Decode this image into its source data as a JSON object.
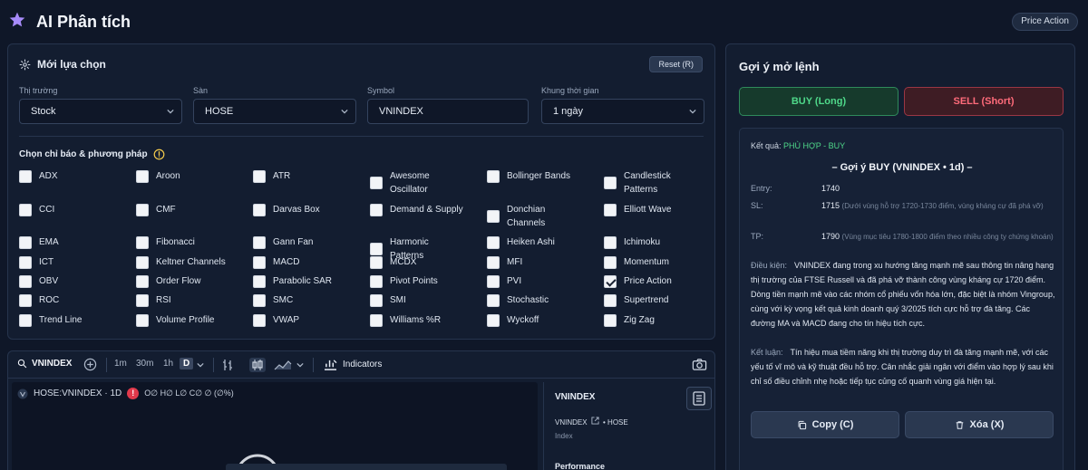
{
  "header": {
    "title": "AI Phân tích",
    "mode_badge": "Price Action"
  },
  "selection": {
    "title": "Mới lựa chọn",
    "reset_label": "Reset (R)",
    "fields": [
      {
        "label": "Thị trường",
        "value": "Stock"
      },
      {
        "label": "Sàn",
        "value": "HOSE"
      },
      {
        "label": "Symbol",
        "value": "VNINDEX"
      },
      {
        "label": "Khung thời gian",
        "value": "1 ngày"
      }
    ],
    "indicators_label": "Chọn chỉ báo & phương pháp",
    "indicators": [
      {
        "label": "ADX",
        "checked": false
      },
      {
        "label": "Aroon",
        "checked": false
      },
      {
        "label": "ATR",
        "checked": false
      },
      {
        "label": "Awesome Oscillator",
        "checked": false
      },
      {
        "label": "Bollinger Bands",
        "checked": false
      },
      {
        "label": "Candlestick Patterns",
        "checked": false
      },
      {
        "label": "CCI",
        "checked": false
      },
      {
        "label": "CMF",
        "checked": false
      },
      {
        "label": "Darvas Box",
        "checked": false
      },
      {
        "label": "Demand & Supply",
        "checked": false
      },
      {
        "label": "Donchian Channels",
        "checked": false
      },
      {
        "label": "Elliott Wave",
        "checked": false
      },
      {
        "label": "EMA",
        "checked": false
      },
      {
        "label": "Fibonacci",
        "checked": false
      },
      {
        "label": "Gann Fan",
        "checked": false
      },
      {
        "label": "Harmonic Patterns",
        "checked": false
      },
      {
        "label": "Heiken Ashi",
        "checked": false
      },
      {
        "label": "Ichimoku",
        "checked": false
      },
      {
        "label": "ICT",
        "checked": false
      },
      {
        "label": "Keltner Channels",
        "checked": false
      },
      {
        "label": "MACD",
        "checked": false
      },
      {
        "label": "MCDX",
        "checked": false
      },
      {
        "label": "MFI",
        "checked": false
      },
      {
        "label": "Momentum",
        "checked": false
      },
      {
        "label": "OBV",
        "checked": false
      },
      {
        "label": "Order Flow",
        "checked": false
      },
      {
        "label": "Parabolic SAR",
        "checked": false
      },
      {
        "label": "Pivot Points",
        "checked": false
      },
      {
        "label": "PVI",
        "checked": false
      },
      {
        "label": "Price Action",
        "checked": true
      },
      {
        "label": "ROC",
        "checked": false
      },
      {
        "label": "RSI",
        "checked": false
      },
      {
        "label": "SMC",
        "checked": false
      },
      {
        "label": "SMI",
        "checked": false
      },
      {
        "label": "Stochastic",
        "checked": false
      },
      {
        "label": "Supertrend",
        "checked": false
      },
      {
        "label": "Trend Line",
        "checked": false
      },
      {
        "label": "Volume Profile",
        "checked": false
      },
      {
        "label": "VWAP",
        "checked": false
      },
      {
        "label": "Williams %R",
        "checked": false
      },
      {
        "label": "Wyckoff",
        "checked": false
      },
      {
        "label": "Zig Zag",
        "checked": false
      }
    ]
  },
  "suggestion": {
    "title": "Gợi ý mở lệnh",
    "buy_label": "BUY (Long)",
    "sell_label": "SELL (Short)",
    "result_key": "Kết quả:",
    "result_value": "PHÙ HỢP - BUY",
    "heading": "– Gợi ý BUY (VNINDEX • 1d) –",
    "entry_key": "Entry:",
    "entry_value": "1740",
    "sl_key": "SL:",
    "sl_value": "1715",
    "sl_note": "(Dưới vùng hỗ trợ 1720-1730 điểm, vùng kháng cự đã phá vỡ)",
    "tp_key": "TP:",
    "tp_value": "1790",
    "tp_note": "(Vùng mục tiêu 1780-1800 điểm theo nhiều công ty chứng khoán)",
    "condition_key": "Điều kiện:",
    "condition_text": "VNINDEX đang trong xu hướng tăng mạnh mẽ sau thông tin nâng hạng thị trường của FTSE Russell và đã phá vỡ thành công vùng kháng cự 1720 điểm. Dòng tiền mạnh mẽ vào các nhóm cổ phiếu vốn hóa lớn, đặc biệt là nhóm Vingroup, cùng với kỳ vọng kết quả kinh doanh quý 3/2025 tích cực hỗ trợ đà tăng. Các đường MA và MACD đang cho tín hiệu tích cực.",
    "conclusion_key": "Kết luận:",
    "conclusion_text": "Tín hiệu mua tiềm năng khi thị trường duy trì đà tăng mạnh mẽ, với các yếu tố vĩ mô và kỹ thuật đều hỗ trợ. Cân nhắc giải ngân với điểm vào hợp lý sau khi chỉ số điều chỉnh nhẹ hoặc tiếp tục củng cố quanh vùng giá hiện tại.",
    "copy_label": "Copy (C)",
    "delete_label": "Xóa (X)"
  },
  "chart": {
    "symbol": "VNINDEX",
    "intervals": [
      "1m",
      "30m",
      "1h",
      "D"
    ],
    "indicators_label": "Indicators",
    "legend_symbol": "HOSE:VNINDEX · 1D",
    "legend_ohlc": "O∅ H∅ L∅ C∅ ∅ (∅%)",
    "side_title": "VNINDEX",
    "side_symbol": "VNINDEX",
    "side_exchange": "• HOSE",
    "side_type": "Index",
    "side_perf": "Performance"
  }
}
